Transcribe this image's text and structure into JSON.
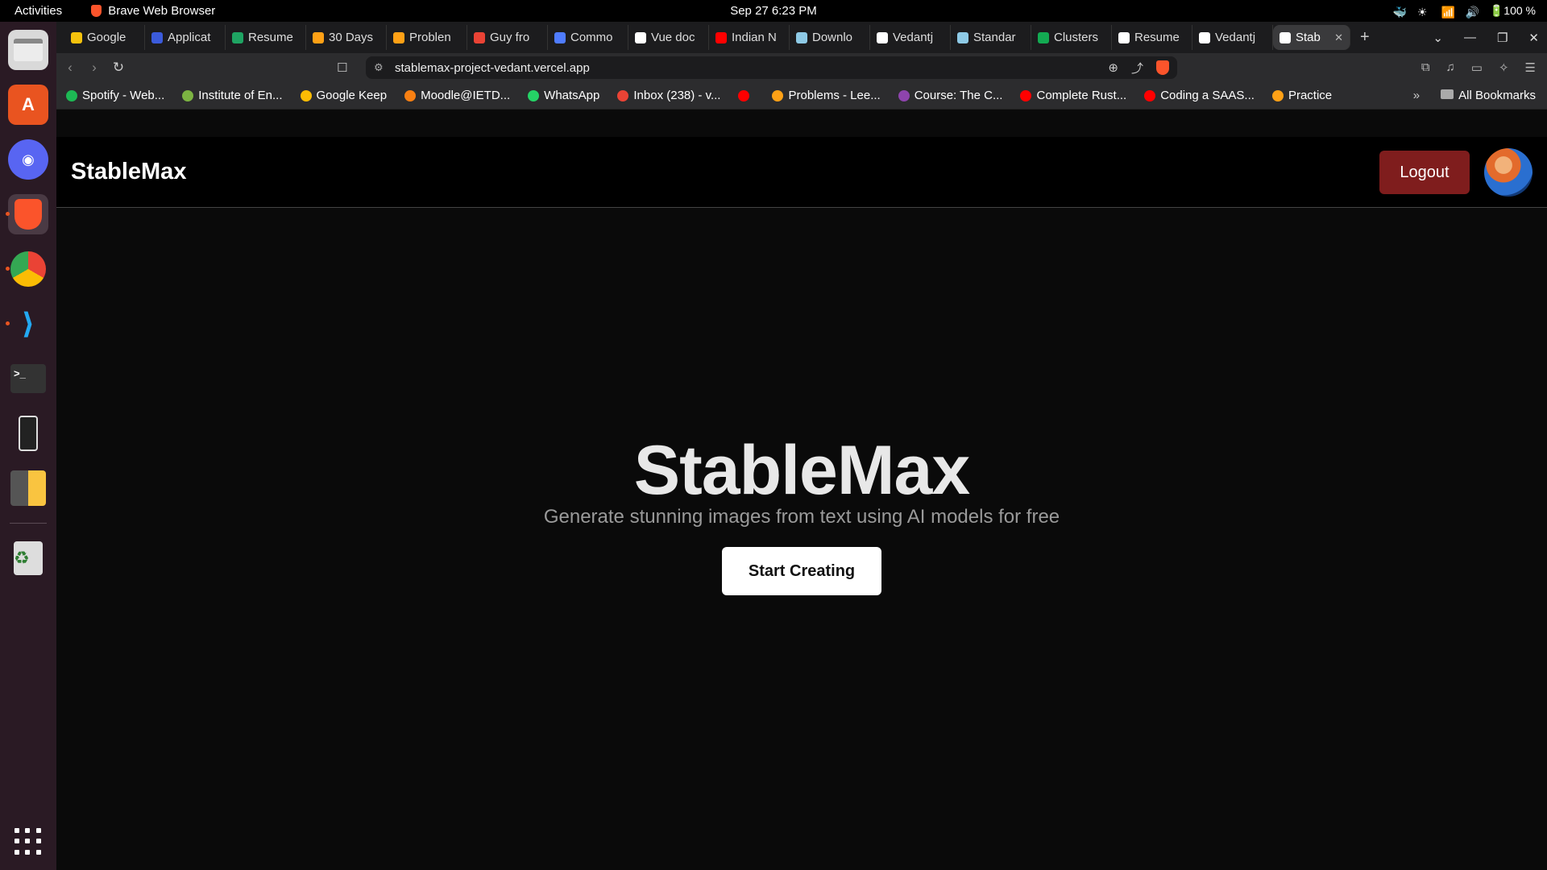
{
  "system": {
    "activities": "Activities",
    "app_name": "Brave Web Browser",
    "clock": "Sep 27   6:23 PM",
    "battery": "100 %"
  },
  "tabs": [
    {
      "label": "Google",
      "color": "#f4c20d"
    },
    {
      "label": "Applicat",
      "color": "#3b5bdb"
    },
    {
      "label": "Resume",
      "color": "#1fa463"
    },
    {
      "label": "30 Days",
      "color": "#ffa116"
    },
    {
      "label": "Problen",
      "color": "#ffa116"
    },
    {
      "label": "Guy fro",
      "color": "#ea4335"
    },
    {
      "label": "Commo",
      "color": "#4f7cff"
    },
    {
      "label": "Vue doc",
      "color": "#ffffff"
    },
    {
      "label": "Indian N",
      "color": "#ff0000"
    },
    {
      "label": "Downlo",
      "color": "#8ecae6"
    },
    {
      "label": "Vedantj",
      "color": "#ffffff"
    },
    {
      "label": "Standar",
      "color": "#8ecae6"
    },
    {
      "label": "Clusters",
      "color": "#13aa52"
    },
    {
      "label": "Resume",
      "color": "#ffffff"
    },
    {
      "label": "Vedantj",
      "color": "#ffffff"
    },
    {
      "label": "Stab",
      "color": "#ffffff"
    }
  ],
  "address_bar": {
    "url": "stablemax-project-vedant.vercel.app"
  },
  "bookmarks": [
    {
      "label": "Spotify - Web...",
      "color": "#1db954"
    },
    {
      "label": "Institute of En...",
      "color": "#7cb342"
    },
    {
      "label": "Google Keep",
      "color": "#fbbc04"
    },
    {
      "label": "Moodle@IETD...",
      "color": "#f98012"
    },
    {
      "label": "WhatsApp",
      "color": "#25d366"
    },
    {
      "label": "Inbox (238) - v...",
      "color": "#ea4335"
    },
    {
      "label": "",
      "color": "#ff0000"
    },
    {
      "label": "Problems - Lee...",
      "color": "#ffa116"
    },
    {
      "label": "Course: The C...",
      "color": "#8e44ad"
    },
    {
      "label": "Complete Rust...",
      "color": "#ff0000"
    },
    {
      "label": "Coding a SAAS...",
      "color": "#ff0000"
    },
    {
      "label": "Practice",
      "color": "#ffa116"
    }
  ],
  "all_bookmarks": "All Bookmarks",
  "site": {
    "brand": "StableMax",
    "logout_label": "Logout",
    "hero_title": "StableMax",
    "hero_subtitle": "Generate stunning images from text using AI models for free",
    "cta_label": "Start Creating"
  }
}
